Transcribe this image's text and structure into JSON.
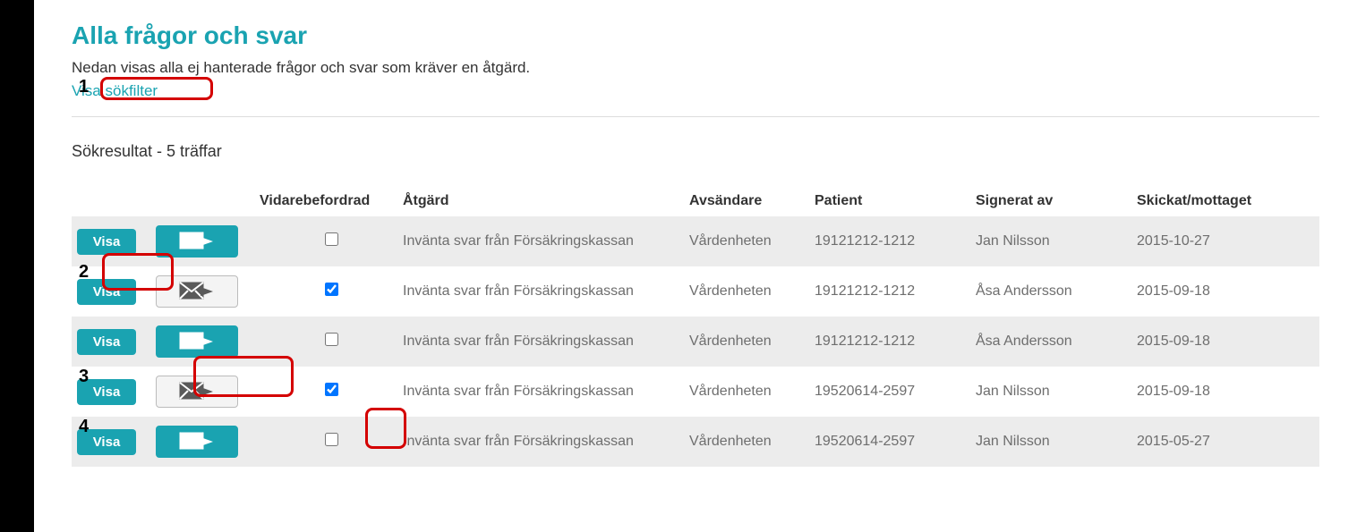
{
  "page": {
    "title": "Alla frågor och svar",
    "subtitle": "Nedan visas alla ej hanterade frågor och svar som kräver en åtgärd.",
    "filter_link": "Visa sökfilter",
    "result_text": "Sökresultat - 5 träffar"
  },
  "columns": {
    "c_visa": "",
    "c_forward": "",
    "c_vidare": "Vidarebefordrad",
    "c_atgard": "Åtgärd",
    "c_avsandare": "Avsändare",
    "c_patient": "Patient",
    "c_signerat": "Signerat av",
    "c_skickat": "Skickat/mottaget"
  },
  "buttons": {
    "visa": "Visa"
  },
  "rows": [
    {
      "forward_active": true,
      "vidare_checked": false,
      "atgard": "Invänta svar från Försäkringskassan",
      "avsandare": "Vårdenheten",
      "patient": "19121212-1212",
      "signerat": "Jan Nilsson",
      "skickat": "2015-10-27"
    },
    {
      "forward_active": false,
      "vidare_checked": true,
      "atgard": "Invänta svar från Försäkringskassan",
      "avsandare": "Vårdenheten",
      "patient": "19121212-1212",
      "signerat": "Åsa Andersson",
      "skickat": "2015-09-18"
    },
    {
      "forward_active": true,
      "vidare_checked": false,
      "atgard": "Invänta svar från Försäkringskassan",
      "avsandare": "Vårdenheten",
      "patient": "19121212-1212",
      "signerat": "Åsa Andersson",
      "skickat": "2015-09-18"
    },
    {
      "forward_active": false,
      "vidare_checked": true,
      "atgard": "Invänta svar från Försäkringskassan",
      "avsandare": "Vårdenheten",
      "patient": "19520614-2597",
      "signerat": "Jan Nilsson",
      "skickat": "2015-09-18"
    },
    {
      "forward_active": true,
      "vidare_checked": false,
      "atgard": "Invänta svar från Försäkringskassan",
      "avsandare": "Vårdenheten",
      "patient": "19520614-2597",
      "signerat": "Jan Nilsson",
      "skickat": "2015-05-27"
    }
  ],
  "annotations": {
    "1": "1",
    "2": "2",
    "3": "3",
    "4": "4"
  }
}
